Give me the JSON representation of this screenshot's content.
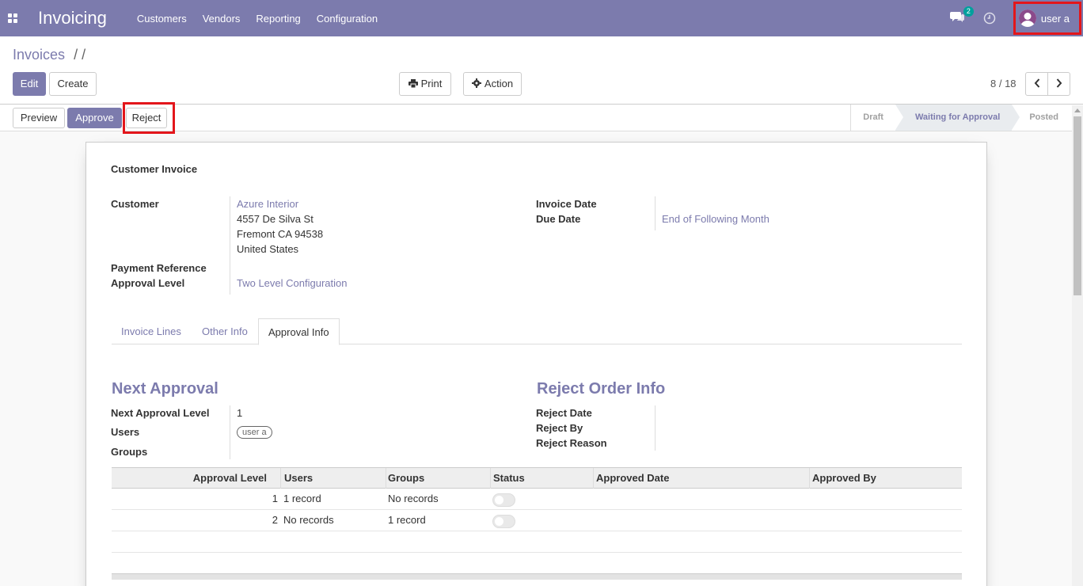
{
  "navbar": {
    "app_title": "Invoicing",
    "menu": [
      "Customers",
      "Vendors",
      "Reporting",
      "Configuration"
    ],
    "chat_count": "2",
    "user_name": "user a",
    "accent_color": "#7c7bad"
  },
  "control_panel": {
    "breadcrumb": "Invoices",
    "breadcrumb_suffix": "/ /",
    "edit_label": "Edit",
    "create_label": "Create",
    "print_label": "Print",
    "action_label": "Action",
    "pager": "8 / 18"
  },
  "statusbar": {
    "preview_label": "Preview",
    "approve_label": "Approve",
    "reject_label": "Reject",
    "stages": [
      "Draft",
      "Waiting for Approval",
      "Posted"
    ],
    "active_stage": "Waiting for Approval"
  },
  "sheet": {
    "title": "Customer Invoice",
    "customer_label": "Customer",
    "customer_name": "Azure Interior",
    "address_line1": "4557 De Silva St",
    "address_line2": "Fremont CA 94538",
    "address_line3": "United States",
    "payment_ref_label": "Payment Reference",
    "approval_level_label": "Approval Level",
    "approval_level_value": "Two Level Configuration",
    "invoice_date_label": "Invoice Date",
    "due_date_label": "Due Date",
    "due_date_value": "End of Following Month",
    "tabs": [
      "Invoice Lines",
      "Other Info",
      "Approval Info"
    ],
    "active_tab": "Approval Info",
    "next_approval": {
      "heading": "Next Approval",
      "level_label": "Next Approval Level",
      "level_value": "1",
      "users_label": "Users",
      "users_tag": "user a",
      "groups_label": "Groups"
    },
    "reject_info": {
      "heading": "Reject Order Info",
      "date_label": "Reject Date",
      "by_label": "Reject By",
      "reason_label": "Reject Reason"
    },
    "table": {
      "columns": [
        "Approval Level",
        "Users",
        "Groups",
        "Status",
        "Approved Date",
        "Approved By"
      ],
      "rows": [
        {
          "level": "1",
          "users": "1 record",
          "groups": "No records",
          "status": "off",
          "approved_date": "",
          "approved_by": ""
        },
        {
          "level": "2",
          "users": "No records",
          "groups": "1 record",
          "status": "off",
          "approved_date": "",
          "approved_by": ""
        }
      ]
    }
  }
}
